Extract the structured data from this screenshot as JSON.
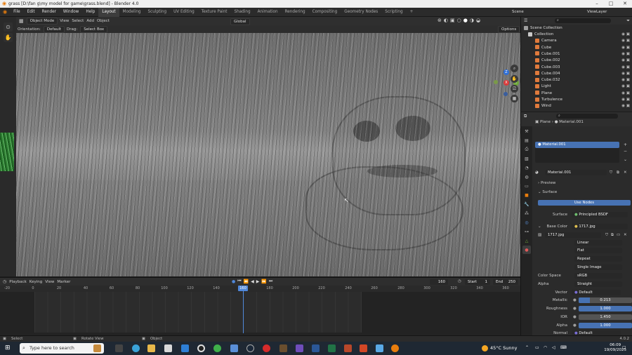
{
  "window": {
    "title": "grass [D:\\fan g\\my model for game\\grass.blend] - Blender 4.0",
    "controls": [
      "–",
      "□",
      "✕"
    ]
  },
  "menu": [
    "File",
    "Edit",
    "Render",
    "Window",
    "Help"
  ],
  "workspaces": [
    {
      "label": "Layout",
      "active": true
    },
    {
      "label": "Modeling"
    },
    {
      "label": "Sculpting"
    },
    {
      "label": "UV Editing"
    },
    {
      "label": "Texture Paint"
    },
    {
      "label": "Shading"
    },
    {
      "label": "Animation"
    },
    {
      "label": "Rendering"
    },
    {
      "label": "Compositing"
    },
    {
      "label": "Geometry Nodes"
    },
    {
      "label": "Scripting"
    }
  ],
  "topbar_right": {
    "scene": "Scene",
    "view_layer": "ViewLayer",
    "add": "+"
  },
  "viewport_header": {
    "mode": "Object Mode",
    "menus": [
      "View",
      "Select",
      "Add",
      "Object"
    ],
    "transform_orientation": "Global",
    "options": "Options"
  },
  "viewport_header2": {
    "orientation_label": "Orientation:",
    "orientation_value": "Default",
    "drag_label": "Drag:",
    "drag_value": "Select Box"
  },
  "tools": [
    "cursor-select",
    "cursor",
    "move",
    "rotate",
    "scale",
    "transform",
    "annotate",
    "measure",
    "add-cube"
  ],
  "navigation_gizmo": {
    "x": "X",
    "y": "Y",
    "z": "Z"
  },
  "timeline": {
    "menus": [
      "Playback",
      "Keying",
      "View",
      "Marker"
    ],
    "current_frame": "160",
    "start_label": "Start",
    "start": "1",
    "end_label": "End",
    "end": "250",
    "ruler": [
      "-20",
      "0",
      "20",
      "40",
      "60",
      "80",
      "100",
      "120",
      "140",
      "160",
      "180",
      "200",
      "220",
      "240",
      "260",
      "280",
      "300",
      "320",
      "340",
      "360"
    ]
  },
  "outliner": {
    "header": "Scene Collection",
    "items": [
      {
        "label": "Collection",
        "indent": 0,
        "color": "#c9c9c9"
      },
      {
        "label": "Camera",
        "indent": 1,
        "color": "#e07a3c"
      },
      {
        "label": "Cube",
        "indent": 1,
        "color": "#e07a3c"
      },
      {
        "label": "Cube.001",
        "indent": 1,
        "color": "#e07a3c"
      },
      {
        "label": "Cube.002",
        "indent": 1,
        "color": "#e07a3c"
      },
      {
        "label": "Cube.003",
        "indent": 1,
        "color": "#e07a3c"
      },
      {
        "label": "Cube.004",
        "indent": 1,
        "color": "#e07a3c"
      },
      {
        "label": "Cube.032",
        "indent": 1,
        "color": "#e07a3c"
      },
      {
        "label": "Light",
        "indent": 1,
        "color": "#e07a3c"
      },
      {
        "label": "Plane",
        "indent": 1,
        "color": "#e07a3c"
      },
      {
        "label": "Turbulence",
        "indent": 1,
        "color": "#e07a3c"
      },
      {
        "label": "Wind",
        "indent": 1,
        "color": "#e07a3c"
      }
    ]
  },
  "properties": {
    "breadcrumb_object": "Plane",
    "breadcrumb_material": "Material.001",
    "material_slot": "Material.001",
    "material_name": "Material.001",
    "preview_label": "Preview",
    "surface_label": "Surface",
    "use_nodes": "Use Nodes",
    "surface_field_label": "Surface",
    "surface_value": "Principled BSDF",
    "base_color_label": "Base Color",
    "base_color_value": "1717.jpg",
    "image_name": "1717.jpg",
    "interpolation": "Linear",
    "projection": "Flat",
    "extension": "Repeat",
    "source": "Single Image",
    "color_space_label": "Color Space",
    "color_space_value": "sRGB",
    "alpha_label": "Alpha",
    "alpha_value": "Straight",
    "vector_label": "Vector",
    "vector_value": "Default",
    "metallic_label": "Metallic",
    "metallic_value": "0.213",
    "metallic_fraction": 0.213,
    "roughness_label": "Roughness",
    "roughness_value": "1.000",
    "ior_label": "IOR",
    "ior_value": "1.450",
    "alpha2_label": "Alpha",
    "alpha2_value": "1.000",
    "normal_label": "Normal",
    "normal_value": "Default"
  },
  "statusbar": {
    "select": "Select",
    "rotate": "Rotate View",
    "object": "Object",
    "version": "4.0.2"
  },
  "taskbar": {
    "search_placeholder": "Type here to search",
    "weather": "45°C Sunny",
    "time": "06:09",
    "date": "19/09/2025"
  }
}
